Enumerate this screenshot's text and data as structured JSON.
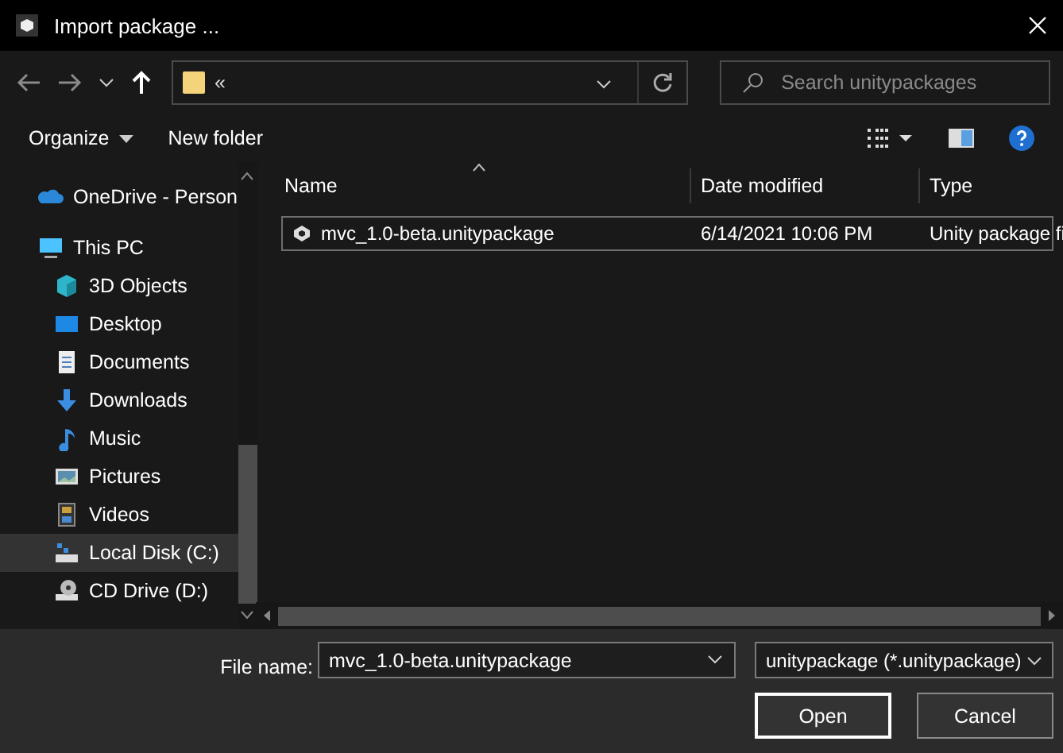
{
  "window": {
    "title": "Import package ..."
  },
  "address_bar": {
    "path": "«"
  },
  "search": {
    "placeholder": "Search unitypackages"
  },
  "toolbar": {
    "organize": "Organize",
    "new_folder": "New folder"
  },
  "sidebar": {
    "items": [
      {
        "label": "OneDrive - Person",
        "kind": "cloud",
        "selected": false
      },
      {
        "label": "This PC",
        "kind": "pc",
        "selected": false,
        "children": [
          {
            "label": "3D Objects",
            "kind": "cube",
            "selected": false
          },
          {
            "label": "Desktop",
            "kind": "desktop",
            "selected": false
          },
          {
            "label": "Documents",
            "kind": "document",
            "selected": false
          },
          {
            "label": "Downloads",
            "kind": "download",
            "selected": false
          },
          {
            "label": "Music",
            "kind": "music",
            "selected": false
          },
          {
            "label": "Pictures",
            "kind": "pictures",
            "selected": false
          },
          {
            "label": "Videos",
            "kind": "videos",
            "selected": false
          },
          {
            "label": "Local Disk (C:)",
            "kind": "disk",
            "selected": true
          },
          {
            "label": "CD Drive (D:)",
            "kind": "cd",
            "selected": false
          }
        ]
      }
    ]
  },
  "table": {
    "columns": [
      "Name",
      "Date modified",
      "Type"
    ],
    "rows": [
      {
        "name": "mvc_1.0-beta.unitypackage",
        "date": "6/14/2021 10:06 PM",
        "type": "Unity package fi",
        "focused": true
      }
    ]
  },
  "file_name": {
    "label": "File name:",
    "value": "mvc_1.0-beta.unitypackage"
  },
  "file_type": {
    "value": "unitypackage (*.unitypackage)"
  },
  "buttons": [
    {
      "label": "Open",
      "default": true
    },
    {
      "label": "Cancel",
      "default": false
    }
  ]
}
